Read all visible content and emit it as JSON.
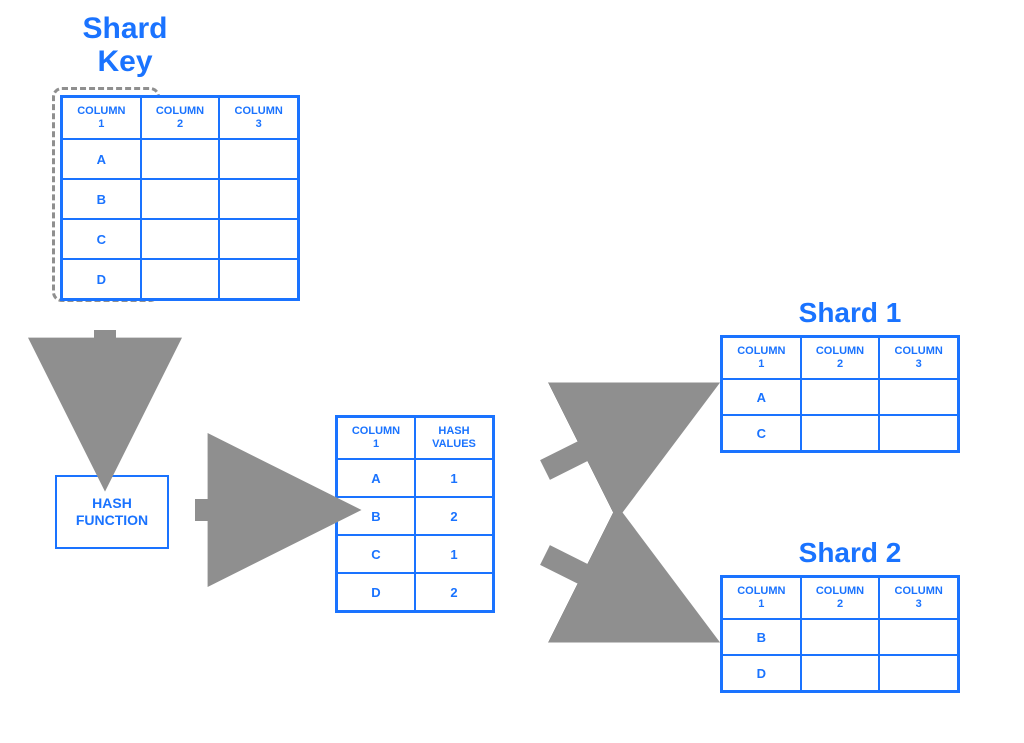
{
  "labels": {
    "shard_key_title": "Shard\nKey",
    "hash_function": "HASH\nFUNCTION",
    "shard1_title": "Shard 1",
    "shard2_title": "Shard 2"
  },
  "source_table": {
    "headers": [
      "COLUMN\n1",
      "COLUMN\n2",
      "COLUMN\n3"
    ],
    "rows": [
      [
        "A",
        "",
        ""
      ],
      [
        "B",
        "",
        ""
      ],
      [
        "C",
        "",
        ""
      ],
      [
        "D",
        "",
        ""
      ]
    ]
  },
  "hash_table": {
    "headers": [
      "COLUMN\n1",
      "HASH\nVALUES"
    ],
    "rows": [
      [
        "A",
        "1"
      ],
      [
        "B",
        "2"
      ],
      [
        "C",
        "1"
      ],
      [
        "D",
        "2"
      ]
    ]
  },
  "shard1_table": {
    "headers": [
      "COLUMN\n1",
      "COLUMN\n2",
      "COLUMN\n3"
    ],
    "rows": [
      [
        "A",
        "",
        ""
      ],
      [
        "C",
        "",
        ""
      ]
    ]
  },
  "shard2_table": {
    "headers": [
      "COLUMN\n1",
      "COLUMN\n2",
      "COLUMN\n3"
    ],
    "rows": [
      [
        "B",
        "",
        ""
      ],
      [
        "D",
        "",
        ""
      ]
    ]
  },
  "chart_data": {
    "type": "diagram",
    "description": "Hash-based sharding: a source table's shard-key column is passed through a hash function producing hash values, which partition rows into Shard 1 and Shard 2.",
    "shard_key_column": "COLUMN 1",
    "source_rows": [
      "A",
      "B",
      "C",
      "D"
    ],
    "hash_map": {
      "A": 1,
      "B": 2,
      "C": 1,
      "D": 2
    },
    "shards": {
      "Shard 1": [
        "A",
        "C"
      ],
      "Shard 2": [
        "B",
        "D"
      ]
    }
  }
}
